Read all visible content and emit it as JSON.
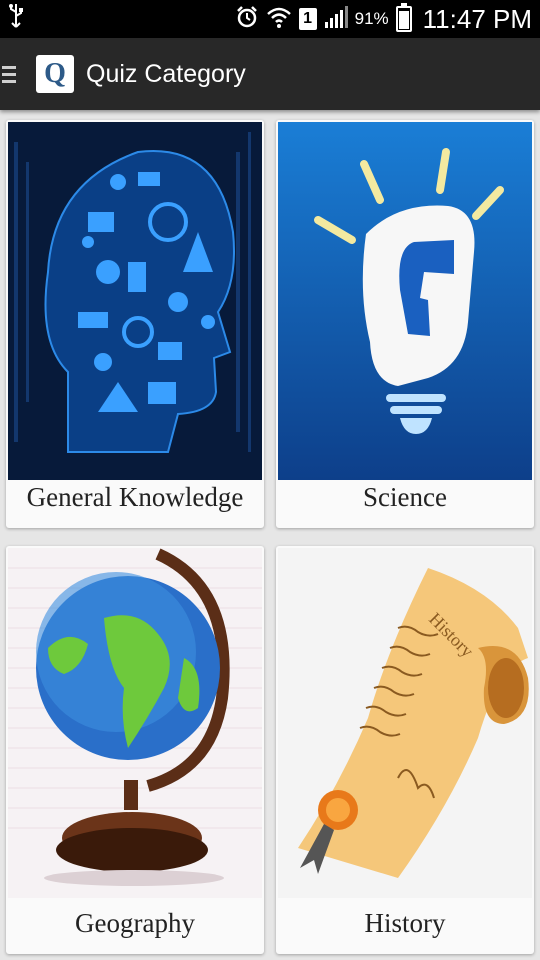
{
  "status_bar": {
    "battery_percent": "91%",
    "time": "11:47 PM",
    "sim_label": "1",
    "icons": [
      "usb-icon",
      "alarm-icon",
      "wifi-icon",
      "sim-icon",
      "signal-icon",
      "battery-icon"
    ]
  },
  "app_bar": {
    "logo_letter": "Q",
    "title": "Quiz Category"
  },
  "categories": [
    {
      "label": "General Knowledge",
      "icon": "head-knowledge-icon"
    },
    {
      "label": "Science",
      "icon": "lightbulb-icon"
    },
    {
      "label": "Geography",
      "icon": "globe-icon"
    },
    {
      "label": "History",
      "icon": "scroll-icon"
    }
  ],
  "colors": {
    "status_bg": "#000000",
    "app_bar_bg": "#282828",
    "page_bg": "#e6e6e6",
    "card_bg": "#fafafa"
  }
}
